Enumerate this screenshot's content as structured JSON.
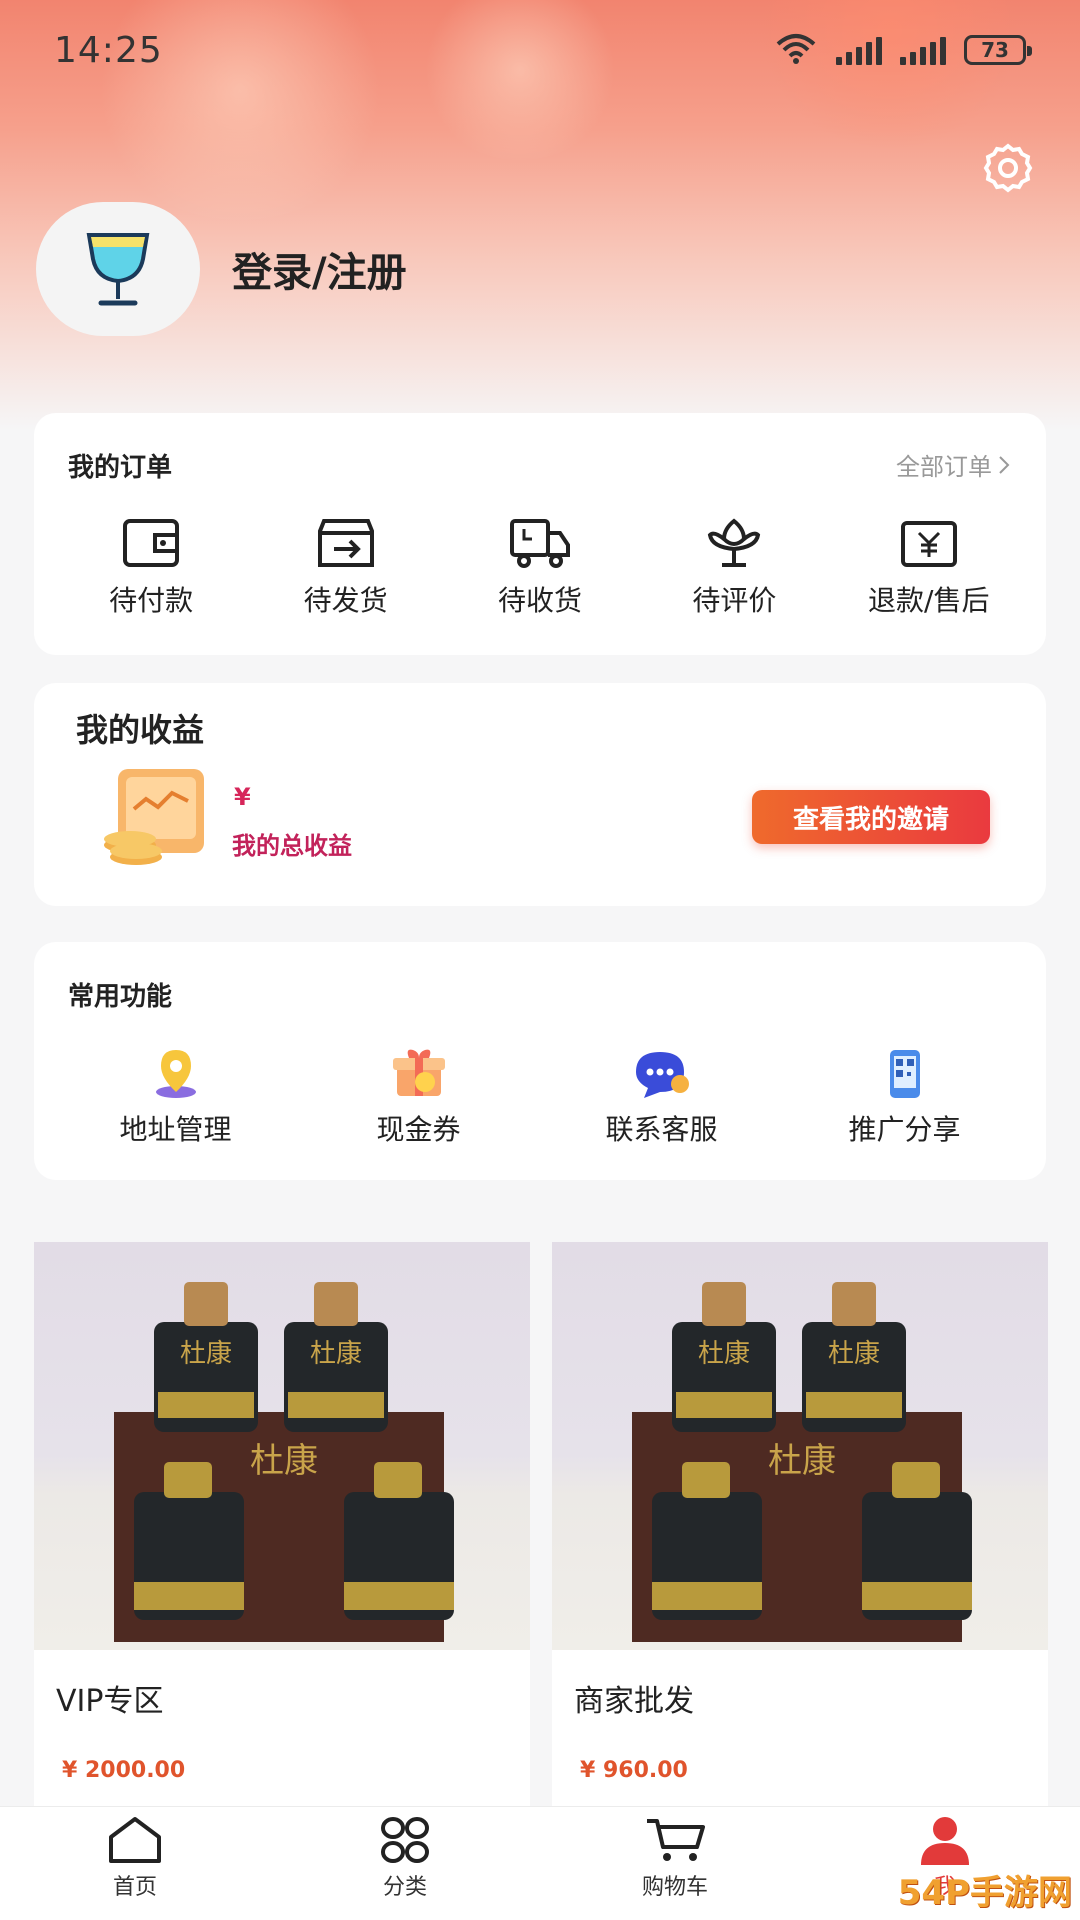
{
  "status_bar": {
    "time": "14:25",
    "battery": "73"
  },
  "profile": {
    "login_label": "登录/注册"
  },
  "orders": {
    "title": "我的订单",
    "all_label": "全部订单",
    "items": [
      {
        "label": "待付款",
        "icon": "wallet-icon"
      },
      {
        "label": "待发货",
        "icon": "ship-icon"
      },
      {
        "label": "待收货",
        "icon": "truck-icon"
      },
      {
        "label": "待评价",
        "icon": "flower-icon"
      },
      {
        "label": "退款/售后",
        "icon": "refund-icon"
      }
    ]
  },
  "earnings": {
    "title": "我的收益",
    "currency": "¥",
    "total_label": "我的总收益",
    "invite_button": "查看我的邀请"
  },
  "functions": {
    "title": "常用功能",
    "items": [
      {
        "label": "地址管理",
        "icon": "location-pin-icon"
      },
      {
        "label": "现金券",
        "icon": "gift-icon"
      },
      {
        "label": "联系客服",
        "icon": "chat-bubble-icon"
      },
      {
        "label": "推广分享",
        "icon": "qr-code-phone-icon"
      }
    ]
  },
  "products": [
    {
      "name": "VIP专区",
      "price": "¥ 2000.00"
    },
    {
      "name": "商家批发",
      "price": "¥ 960.00"
    }
  ],
  "nav": [
    {
      "label": "首页",
      "icon": "home-icon"
    },
    {
      "label": "分类",
      "icon": "category-icon"
    },
    {
      "label": "购物车",
      "icon": "cart-icon"
    },
    {
      "label": "我",
      "icon": "user-icon"
    }
  ],
  "watermark": "54P手游网",
  "colors": {
    "accent": "#ea3a3f",
    "price": "#e0542c",
    "earn_text": "#c2225a"
  }
}
